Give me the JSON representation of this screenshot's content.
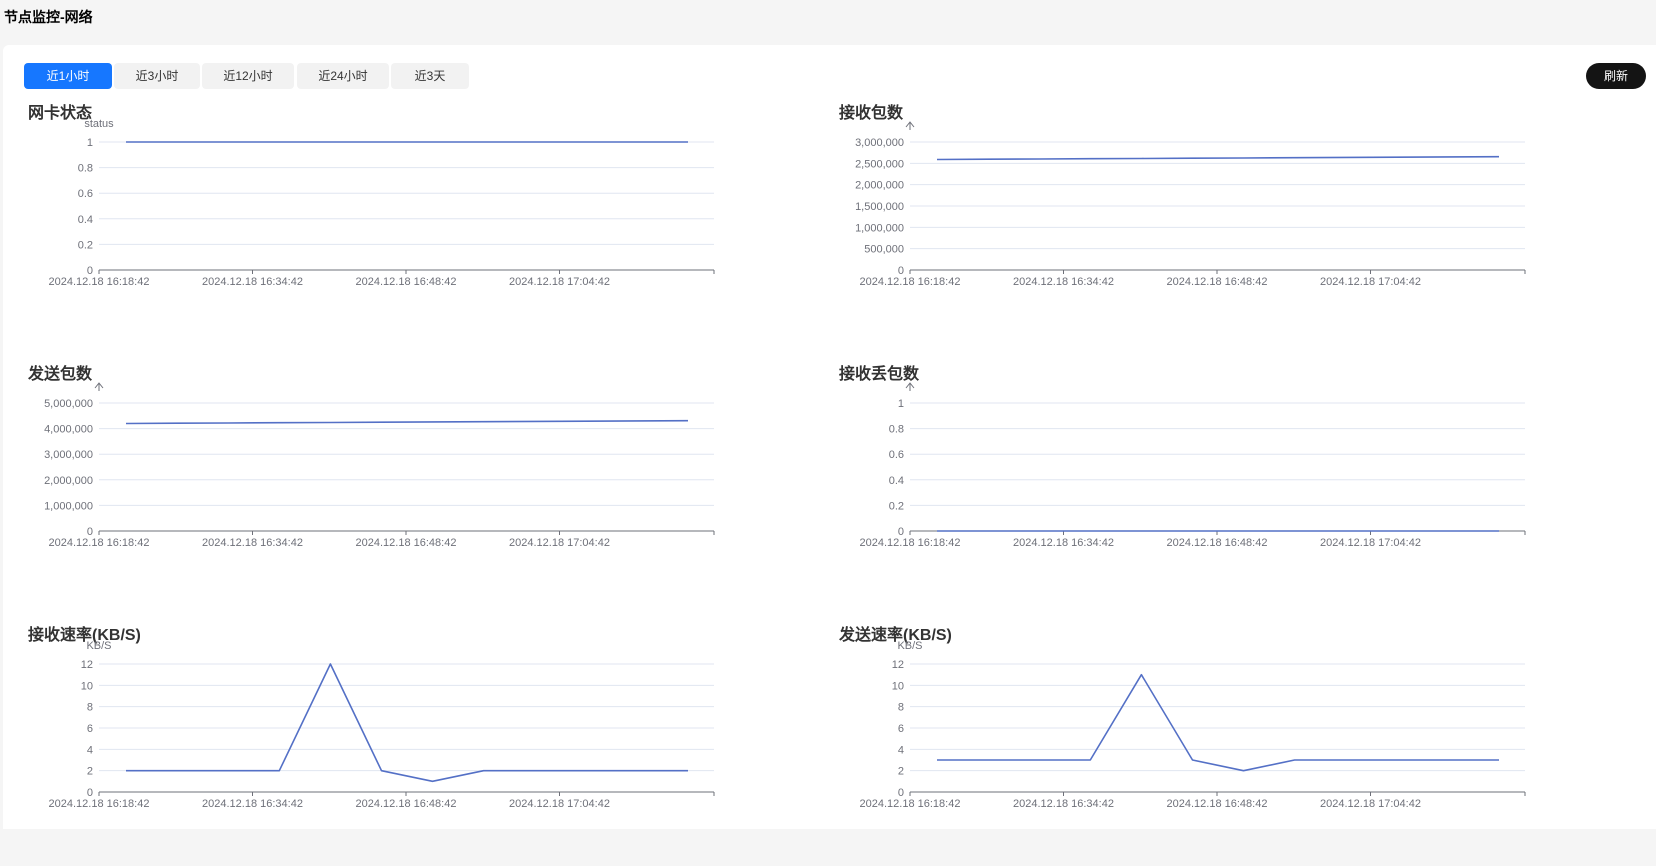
{
  "page": {
    "title": "节点监控-网络"
  },
  "toolbar": {
    "tabs": [
      {
        "label": "近1小时",
        "active": true
      },
      {
        "label": "近3小时",
        "active": false
      },
      {
        "label": "近12小时",
        "active": false
      },
      {
        "label": "近24小时",
        "active": false
      },
      {
        "label": "近3天",
        "active": false
      }
    ],
    "refresh_label": "刷新"
  },
  "colors": {
    "line": "#5470c6",
    "accent": "#1677ff",
    "refresh_bg": "#141414"
  },
  "chart_data": [
    {
      "type": "line",
      "title": "网卡状态",
      "ylabel": "status",
      "x_ticks": [
        "2024.12.18 16:18:42",
        "2024.12.18 16:34:42",
        "2024.12.18 16:48:42",
        "2024.12.18 17:04:42"
      ],
      "ylim": [
        0,
        1
      ],
      "y_ticks": [
        0,
        0.2,
        0.4,
        0.6,
        0.8,
        1
      ],
      "y_tick_labels": [
        "0",
        "0.2",
        "0.4",
        "0.6",
        "0.8",
        "1"
      ],
      "values": [
        1,
        1,
        1,
        1,
        1,
        1,
        1,
        1,
        1,
        1,
        1,
        1
      ]
    },
    {
      "type": "line",
      "title": "接收包数",
      "ylabel": "",
      "x_ticks": [
        "2024.12.18 16:18:42",
        "2024.12.18 16:34:42",
        "2024.12.18 16:48:42",
        "2024.12.18 17:04:42"
      ],
      "ylim": [
        0,
        3000000
      ],
      "y_ticks": [
        0,
        500000,
        1000000,
        1500000,
        2000000,
        2500000,
        3000000
      ],
      "y_tick_labels": [
        "0",
        "500,000",
        "1,000,000",
        "1,500,000",
        "2,000,000",
        "2,500,000",
        "3,000,000"
      ],
      "values": [
        2590000,
        2596000,
        2602000,
        2608000,
        2614000,
        2620000,
        2626000,
        2632000,
        2638000,
        2644000,
        2650000,
        2656000
      ]
    },
    {
      "type": "line",
      "title": "发送包数",
      "ylabel": "",
      "x_ticks": [
        "2024.12.18 16:18:42",
        "2024.12.18 16:34:42",
        "2024.12.18 16:48:42",
        "2024.12.18 17:04:42"
      ],
      "ylim": [
        0,
        5000000
      ],
      "y_ticks": [
        0,
        1000000,
        2000000,
        3000000,
        4000000,
        5000000
      ],
      "y_tick_labels": [
        "0",
        "1,000,000",
        "2,000,000",
        "3,000,000",
        "4,000,000",
        "5,000,000"
      ],
      "values": [
        4200000,
        4210000,
        4220000,
        4230000,
        4240000,
        4250000,
        4260000,
        4270000,
        4280000,
        4290000,
        4300000,
        4310000
      ]
    },
    {
      "type": "line",
      "title": "接收丢包数",
      "ylabel": "",
      "x_ticks": [
        "2024.12.18 16:18:42",
        "2024.12.18 16:34:42",
        "2024.12.18 16:48:42",
        "2024.12.18 17:04:42"
      ],
      "ylim": [
        0,
        1
      ],
      "y_ticks": [
        0,
        0.2,
        0.4,
        0.6,
        0.8,
        1
      ],
      "y_tick_labels": [
        "0",
        "0.2",
        "0.4",
        "0.6",
        "0.8",
        "1"
      ],
      "values": [
        0,
        0,
        0,
        0,
        0,
        0,
        0,
        0,
        0,
        0,
        0,
        0
      ]
    },
    {
      "type": "line",
      "title": "接收速率(KB/S)",
      "ylabel": "KB/S",
      "x_ticks": [
        "2024.12.18 16:18:42",
        "2024.12.18 16:34:42",
        "2024.12.18 16:48:42",
        "2024.12.18 17:04:42"
      ],
      "ylim": [
        0,
        12
      ],
      "y_ticks": [
        0,
        2,
        4,
        6,
        8,
        10,
        12
      ],
      "y_tick_labels": [
        "0",
        "2",
        "4",
        "6",
        "8",
        "10",
        "12"
      ],
      "values": [
        2,
        2,
        2,
        2,
        12,
        2,
        1,
        2,
        2,
        2,
        2,
        2
      ]
    },
    {
      "type": "line",
      "title": "发送速率(KB/S)",
      "ylabel": "KB/S",
      "x_ticks": [
        "2024.12.18 16:18:42",
        "2024.12.18 16:34:42",
        "2024.12.18 16:48:42",
        "2024.12.18 17:04:42"
      ],
      "ylim": [
        0,
        12
      ],
      "y_ticks": [
        0,
        2,
        4,
        6,
        8,
        10,
        12
      ],
      "y_tick_labels": [
        "0",
        "2",
        "4",
        "6",
        "8",
        "10",
        "12"
      ],
      "values": [
        3,
        3,
        3,
        3,
        11,
        3,
        2,
        3,
        3,
        3,
        3,
        3
      ]
    }
  ]
}
